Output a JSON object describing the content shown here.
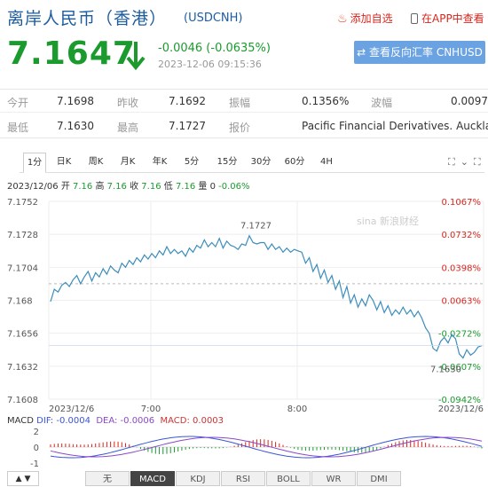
{
  "header": {
    "title": "离岸人民币（香港）",
    "symbol": "(USDCNH)",
    "add_favorite": "添加自选",
    "app_view": "在APP中查看",
    "price": "7.1647",
    "change": "-0.0046 (-0.0635%)",
    "timestamp": "2023-12-06 09:15:36",
    "compare_button": "查看反向汇率 CNHUSD"
  },
  "quote": {
    "row1": [
      {
        "label": "今开",
        "value": "7.1698"
      },
      {
        "label": "昨收",
        "value": "7.1692"
      },
      {
        "label": "振幅",
        "value": "0.1356%"
      },
      {
        "label": "波幅",
        "value": "0.0097"
      }
    ],
    "row2": [
      {
        "label": "最低",
        "value": "7.1630"
      },
      {
        "label": "最高",
        "value": "7.1727"
      },
      {
        "label": "报价",
        "value": "Pacific Financial Derivatives. Auckland"
      }
    ]
  },
  "tabs": [
    "1分",
    "日K",
    "周K",
    "月K",
    "年K",
    "5分",
    "15分",
    "30分",
    "60分",
    "4H"
  ],
  "active_tab": "1分",
  "ohlc": {
    "date": "2023/12/06",
    "open_label": "开",
    "open": "7.16",
    "high_label": "高",
    "high": "7.16",
    "close_label": "收",
    "close": "7.16",
    "low_label": "低",
    "low": "7.16",
    "volume_label": "量",
    "volume": "0",
    "change": "-0.06%"
  },
  "chart_data": {
    "type": "line",
    "y_ticks": [
      "7.1752",
      "7.1728",
      "7.1704",
      "7.168",
      "7.1656",
      "7.1632",
      "7.1608"
    ],
    "pct_ticks": [
      "0.1067%",
      "0.0732%",
      "0.0398%",
      "0.0063%",
      "-0.0272%",
      "-0.0607%",
      "-0.0942%"
    ],
    "x_ticks": [
      "2023/12/6",
      "7:00",
      "8:00",
      "2023/12/6"
    ],
    "ylim": [
      7.1608,
      7.1752
    ],
    "prev_close": 7.1692,
    "high_annotation": "7.1727",
    "low_annotation": "7.1630",
    "watermark": "sina 新浪财经",
    "series": [
      {
        "values": [
          7.1679,
          7.1688,
          7.1686,
          7.1691,
          7.1693,
          7.169,
          7.1695,
          7.1698,
          7.1692,
          7.1697,
          7.1701,
          7.1694,
          7.17,
          7.1697,
          7.1703,
          7.1699,
          7.1705,
          7.1702,
          7.17,
          7.1707,
          7.1704,
          7.1709,
          7.1706,
          7.1711,
          7.1708,
          7.1713,
          7.171,
          7.1714,
          7.1711,
          7.1716,
          7.1713,
          7.1719,
          7.1714,
          7.1717,
          7.1714,
          7.1716,
          7.1712,
          7.1718,
          7.1715,
          7.172,
          7.1718,
          7.1724,
          7.1719,
          7.1722,
          7.1719,
          7.1725,
          7.1718,
          7.1723,
          7.172,
          7.1719,
          7.1717,
          7.1721,
          7.172,
          7.1727,
          7.1722,
          7.1721,
          7.1722,
          7.1722,
          7.1717,
          7.1721,
          7.1717,
          7.1719,
          7.1715,
          7.1718,
          7.1715,
          7.1717,
          7.1716,
          7.1715,
          7.1707,
          7.1711,
          7.1701,
          7.1706,
          7.1696,
          7.1702,
          7.1693,
          7.1698,
          7.1688,
          7.1694,
          7.1682,
          7.169,
          7.1678,
          7.1684,
          7.1675,
          7.1681,
          7.1676,
          7.1684,
          7.168,
          7.1673,
          7.1679,
          7.1671,
          7.1676,
          7.1669,
          7.1673,
          7.167,
          7.1675,
          7.167,
          7.1673,
          7.1668,
          7.1672,
          7.1667,
          7.166,
          7.1656,
          7.1645,
          7.1643,
          7.165,
          7.1653,
          7.1649,
          7.1655,
          7.1652,
          7.1641,
          7.1638,
          7.1644,
          7.164,
          7.1642,
          7.1646,
          7.1647
        ]
      }
    ]
  },
  "macd": {
    "label": "MACD",
    "dif": "DIF: -0.0004",
    "dea": "DEA: -0.0006",
    "macd": "MACD: 0.0003",
    "ticks": [
      "2",
      "0",
      "-1"
    ]
  },
  "indicator_tabs": [
    "无",
    "MACD",
    "KDJ",
    "RSI",
    "BOLL",
    "WR",
    "DMI"
  ],
  "active_indicator": "MACD",
  "colors": {
    "up": "#d7261e",
    "down": "#1b9a2e",
    "line": "#3c8dbc",
    "accent": "#1d5c9e"
  }
}
